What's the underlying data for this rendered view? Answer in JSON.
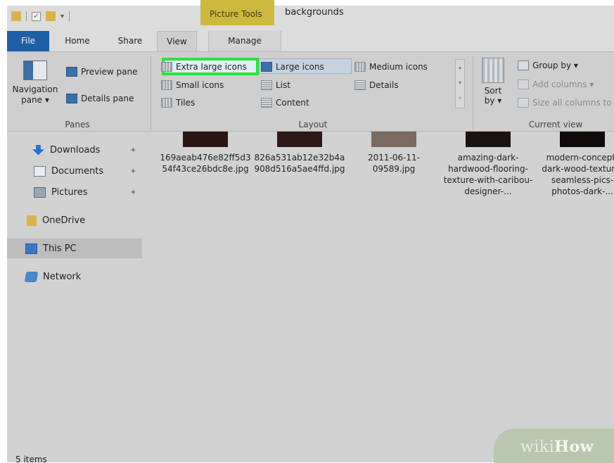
{
  "window": {
    "contextual_tab_label": "Picture Tools",
    "title": "backgrounds"
  },
  "tabs": {
    "file": "File",
    "home": "Home",
    "share": "Share",
    "view": "View",
    "manage": "Manage"
  },
  "ribbon": {
    "panes": {
      "navigation_pane": "Navigation pane",
      "navigation_pane_arrow": "▾",
      "preview_pane": "Preview pane",
      "details_pane": "Details pane",
      "group_label": "Panes"
    },
    "layout": {
      "extra_large_icons": "Extra large icons",
      "large_icons": "Large icons",
      "medium_icons": "Medium icons",
      "small_icons": "Small icons",
      "list": "List",
      "details": "Details",
      "tiles": "Tiles",
      "content": "Content",
      "group_label": "Layout"
    },
    "current_view": {
      "sort_by": "Sort by",
      "sort_by_arrow": "▾",
      "group_by": "Group by ▾",
      "add_columns": "Add columns ▾",
      "size_all_columns": "Size all columns to fit",
      "group_label": "Current view"
    }
  },
  "nav": {
    "items": [
      {
        "label": "Downloads",
        "pinned": true
      },
      {
        "label": "Documents",
        "pinned": true
      },
      {
        "label": "Pictures",
        "pinned": true
      },
      {
        "label": "OneDrive",
        "pinned": false
      },
      {
        "label": "This PC",
        "pinned": false,
        "selected": true
      },
      {
        "label": "Network",
        "pinned": false
      }
    ]
  },
  "files": [
    {
      "name": "169aeab476e82ff5d354f43ce26bdc8e.jpg",
      "thumb_color": "#2b1512"
    },
    {
      "name": "826a531ab12e32b4a908d516a5ae4ffd.jpg",
      "thumb_color": "#2e1814"
    },
    {
      "name": "2011-06-11-09589.jpg",
      "thumb_color": "#7a6a62"
    },
    {
      "name": "amazing-dark-hardwood-flooring-texture-with-caribou-designer-...",
      "thumb_color": "#1a1210"
    },
    {
      "name": "modern-concept-dark-wood-texture-seamless-pics-photos-dark-...",
      "thumb_color": "#0f0b0a"
    }
  ],
  "status": {
    "item_count": "5 items"
  },
  "watermark": {
    "text_a": "wiki",
    "text_b": "How"
  },
  "colors": {
    "highlight": "#27e43a",
    "file_tab": "#1f5fa6",
    "contextual_tab": "#cdb93d"
  }
}
